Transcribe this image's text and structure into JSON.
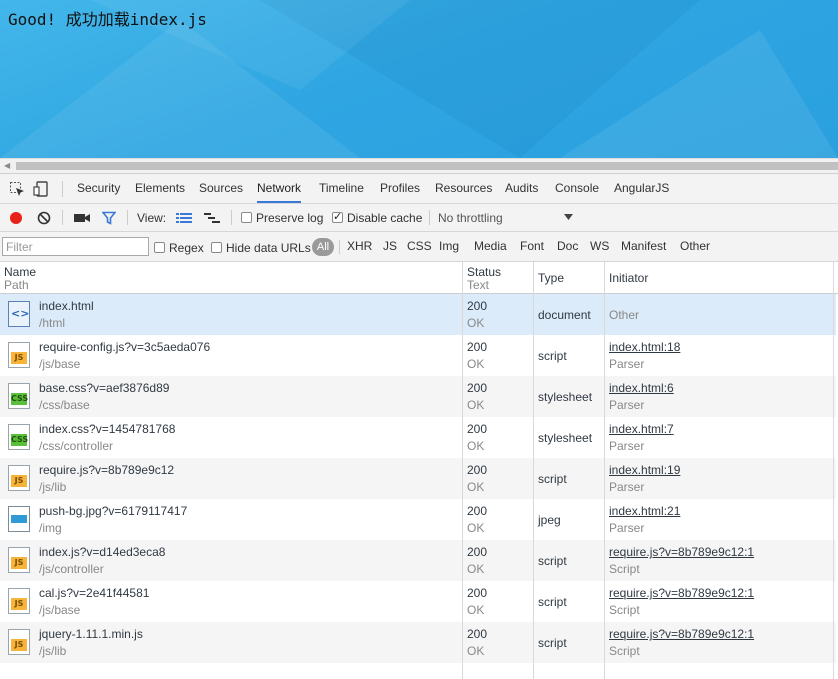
{
  "page": {
    "text": "Good! 成功加载index.js"
  },
  "devtools": {
    "tabs": [
      "Security",
      "Elements",
      "Sources",
      "Network",
      "Timeline",
      "Profiles",
      "Resources",
      "Audits",
      "Console",
      "AngularJS"
    ],
    "active_tab": "Network",
    "toolbar": {
      "view_label": "View:",
      "preserve_log": "Preserve log",
      "disable_cache": "Disable cache",
      "throttling": "No throttling"
    },
    "filter": {
      "placeholder": "Filter",
      "regex": "Regex",
      "hide_data_urls": "Hide data URLs",
      "all": "All",
      "types": [
        "XHR",
        "JS",
        "CSS",
        "Img",
        "Media",
        "Font",
        "Doc",
        "WS",
        "Manifest",
        "Other"
      ]
    },
    "columns": {
      "name": "Name",
      "path": "Path",
      "status": "Status",
      "text": "Text",
      "type": "Type",
      "initiator": "Initiator"
    },
    "rows": [
      {
        "icon": "html-file-icon",
        "name": "index.html",
        "path": "/html",
        "status": "200",
        "text": "OK",
        "type": "document",
        "initiator": "Other",
        "initiator_sub": ""
      },
      {
        "icon": "js-file-icon",
        "name": "require-config.js?v=3c5aeda076",
        "path": "/js/base",
        "status": "200",
        "text": "OK",
        "type": "script",
        "initiator": "index.html:18",
        "initiator_sub": "Parser"
      },
      {
        "icon": "css-file-icon",
        "name": "base.css?v=aef3876d89",
        "path": "/css/base",
        "status": "200",
        "text": "OK",
        "type": "stylesheet",
        "initiator": "index.html:6",
        "initiator_sub": "Parser"
      },
      {
        "icon": "css-file-icon",
        "name": "index.css?v=1454781768",
        "path": "/css/controller",
        "status": "200",
        "text": "OK",
        "type": "stylesheet",
        "initiator": "index.html:7",
        "initiator_sub": "Parser"
      },
      {
        "icon": "js-file-icon",
        "name": "require.js?v=8b789e9c12",
        "path": "/js/lib",
        "status": "200",
        "text": "OK",
        "type": "script",
        "initiator": "index.html:19",
        "initiator_sub": "Parser"
      },
      {
        "icon": "image-file-icon",
        "name": "push-bg.jpg?v=6179117417",
        "path": "/img",
        "status": "200",
        "text": "OK",
        "type": "jpeg",
        "initiator": "index.html:21",
        "initiator_sub": "Parser"
      },
      {
        "icon": "js-file-icon",
        "name": "index.js?v=d14ed3eca8",
        "path": "/js/controller",
        "status": "200",
        "text": "OK",
        "type": "script",
        "initiator": "require.js?v=8b789e9c12:1",
        "initiator_sub": "Script"
      },
      {
        "icon": "js-file-icon",
        "name": "cal.js?v=2e41f44581",
        "path": "/js/base",
        "status": "200",
        "text": "OK",
        "type": "script",
        "initiator": "require.js?v=8b789e9c12:1",
        "initiator_sub": "Script"
      },
      {
        "icon": "js-file-icon",
        "name": "jquery-1.11.1.min.js",
        "path": "/js/lib",
        "status": "200",
        "text": "OK",
        "type": "script",
        "initiator": "require.js?v=8b789e9c12:1",
        "initiator_sub": "Script"
      }
    ],
    "icon_labels": {
      "js": "JS",
      "css": "CSS",
      "html": "<>"
    },
    "colors": {
      "record": "#e8211a",
      "filter_active": "#3879d9",
      "selected_row": "#dcebfa",
      "page_bg": "#2fa6e2"
    }
  }
}
